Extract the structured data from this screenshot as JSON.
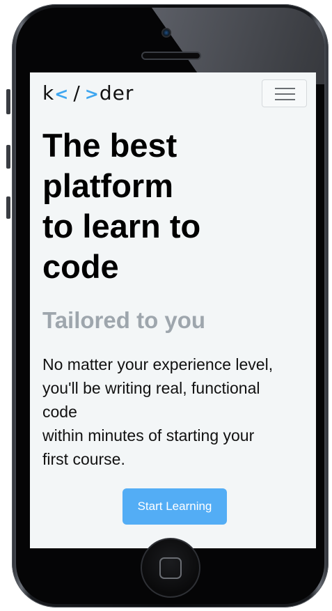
{
  "brand": {
    "left": "k",
    "lt": "<",
    "slash": "/",
    "gt": ">",
    "right": "der"
  },
  "nav": {
    "menu_icon": "hamburger-menu-icon"
  },
  "hero": {
    "title_lines": [
      "The best",
      "platform",
      "to learn to",
      "code"
    ],
    "subtitle": "Tailored to you",
    "description_lines": [
      "No matter your experience level,",
      "you'll be writing real, functional",
      "code",
      "within minutes of starting your",
      "first course."
    ],
    "cta_label": "Start Learning"
  },
  "colors": {
    "accent": "#3ea6f0",
    "button": "#53adf5",
    "subtitle": "#9ea6ad",
    "background": "#f3f6f7"
  },
  "device": {
    "camera_icon": "camera-icon",
    "speaker_icon": "speaker-grille",
    "home_icon": "home-button-icon"
  }
}
